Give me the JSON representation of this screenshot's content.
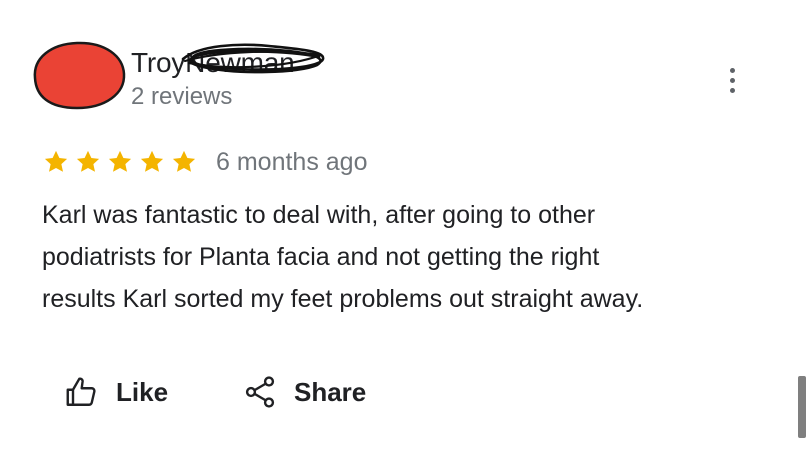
{
  "reviewer": {
    "first_name": "Troy",
    "surname": "Newman",
    "reviews_count": "2 reviews",
    "avatar_color": "#ea4335"
  },
  "rating": {
    "stars": 5,
    "max_stars": 5,
    "star_color": "#f4b400",
    "time_ago": "6 months ago"
  },
  "review": {
    "text_lines": [
      "Karl was fantastic to deal with, after going to other",
      "podiatrists for Planta facia and not getting the right",
      "results Karl sorted my feet problems out straight away."
    ]
  },
  "actions": {
    "like": {
      "label": "Like",
      "icon": "thumb-up-icon"
    },
    "share": {
      "label": "Share",
      "icon": "share-icon"
    },
    "more": {
      "icon": "more-vertical-icon"
    }
  }
}
